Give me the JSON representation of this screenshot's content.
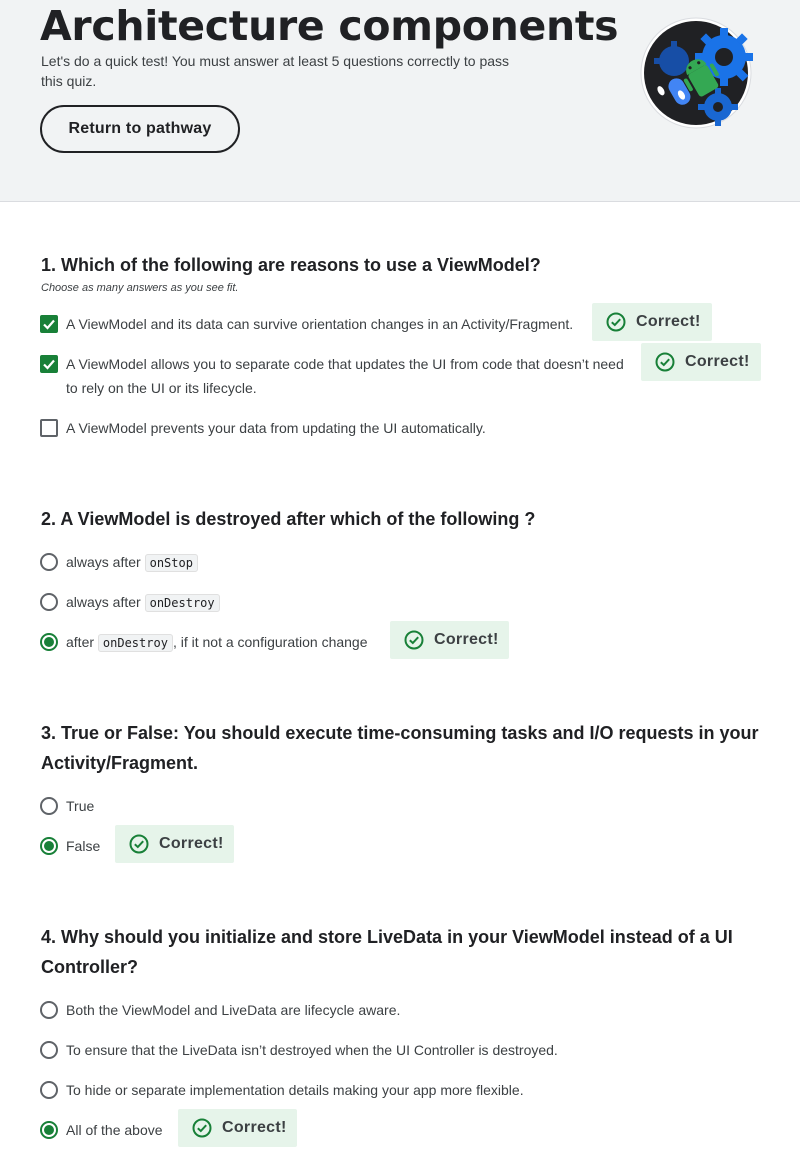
{
  "header": {
    "title": "Architecture components",
    "subtitle": "Let's do a quick test! You must answer at least 5 questions correctly to pass this quiz.",
    "return_button": "Return to pathway",
    "badge_icon": "android-gears-badge-icon"
  },
  "colors": {
    "accent": "#188038",
    "correct_bg": "#e6f4ea",
    "header_bg": "#f1f3f4"
  },
  "correct_label": "Correct!",
  "q1": {
    "question": "1. Which of the following are reasons to use a ViewModel?",
    "hint": "Choose as many answers as you see fit.",
    "options": [
      {
        "text": "A ViewModel and its data can survive orientation changes in an Activity/Fragment.",
        "checked": true
      },
      {
        "text": "A ViewModel allows you to separate code that updates the UI from code that doesn’t need to rely on the UI or its lifecycle.",
        "checked": true
      },
      {
        "text": "A ViewModel prevents your data from updating the UI automatically.",
        "checked": false
      }
    ]
  },
  "q2": {
    "question": "2. A ViewModel is destroyed after which of the following ?",
    "options": [
      {
        "pre": "always after",
        "code": "onStop",
        "post": "",
        "checked": false
      },
      {
        "pre": "always after",
        "code": "onDestroy",
        "post": "",
        "checked": false
      },
      {
        "pre": "after",
        "code": "onDestroy",
        "post": ", if it not a configuration change",
        "checked": true
      }
    ]
  },
  "q3": {
    "question": "3. True or False: You should execute time-consuming tasks and I/O requests in your Activity/Fragment.",
    "options": [
      {
        "text": "True",
        "checked": false
      },
      {
        "text": "False",
        "checked": true
      }
    ]
  },
  "q4": {
    "question": "4. Why should you initialize and store LiveData in your ViewModel instead of a UI Controller?",
    "options": [
      {
        "text": "Both the ViewModel and LiveData are lifecycle aware.",
        "checked": false
      },
      {
        "text": "To ensure that the LiveData isn’t destroyed when the UI Controller is destroyed.",
        "checked": false
      },
      {
        "text": "To hide or separate implementation details making your app more flexible.",
        "checked": false
      },
      {
        "text": "All of the above",
        "checked": true
      }
    ]
  }
}
